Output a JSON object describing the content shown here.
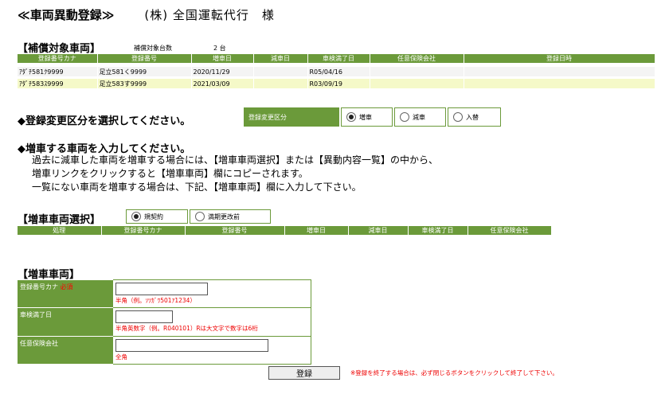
{
  "header": {
    "title": "≪車両異動登録≫",
    "customer": "(株) 全国運転代行　様"
  },
  "insured": {
    "heading": "【補償対象車両】",
    "count_label": "補償対象台数",
    "count_value": "2 台",
    "columns": [
      "登録番号カナ",
      "登録番号",
      "増車日",
      "減車日",
      "車検満了日",
      "任意保険会社",
      "登録日時"
    ],
    "rows": [
      [
        "ｱﾀﾞﾁ581ｸ9999",
        "足立581く9999",
        "2020/11/29",
        "",
        "R05/04/16",
        "",
        ""
      ],
      [
        "ｱﾀﾞﾁ583ｽ9999",
        "足立583す9999",
        "2021/03/09",
        "",
        "R03/09/19",
        "",
        ""
      ]
    ]
  },
  "change_type": {
    "prompt": "◆登録変更区分を選択してください。",
    "label": "登録変更区分",
    "options": [
      "増車",
      "減車",
      "入替"
    ],
    "selected": "増車"
  },
  "add_instructions": {
    "prompt": "◆増車する車両を入力してください。",
    "lines": [
      "過去に減車した車両を増車する場合には、【増車車両選択】または【異動内容一覧】の中から、",
      "増車リンクをクリックすると【増車車両】欄にコピーされます。",
      "一覧にない車両を増車する場合は、下記、【増車車両】欄に入力して下さい。"
    ]
  },
  "select_vehicle": {
    "heading": "【増車車両選択】",
    "options": [
      "規契約",
      "満期更改前"
    ],
    "selected": "規契約",
    "columns": [
      "処理",
      "登録番号カナ",
      "登録番号",
      "増車日",
      "減車日",
      "車検満了日",
      "任意保険会社"
    ]
  },
  "form": {
    "heading": "【増車車両】",
    "fields": [
      {
        "label": "登録番号カナ",
        "required": "必須",
        "value": "",
        "hint": "半角（例。ｿﾂｶﾞﾜ501ｱ1234）"
      },
      {
        "label": "車検満了日",
        "required": "",
        "value": "",
        "hint": "半角英数字（例。R040101）Rは大文字で数字は6桁"
      },
      {
        "label": "任意保険会社",
        "required": "",
        "value": "",
        "hint": "全角"
      }
    ]
  },
  "actions": {
    "register": "登録",
    "note": "※登録を終了する場合は、必ず閉じるボタンをクリックして終了して下さい。"
  },
  "colors": {
    "header_green": "#6b9a3a",
    "hint_red": "#e00000",
    "row_highlight": "#f5f9c8"
  }
}
